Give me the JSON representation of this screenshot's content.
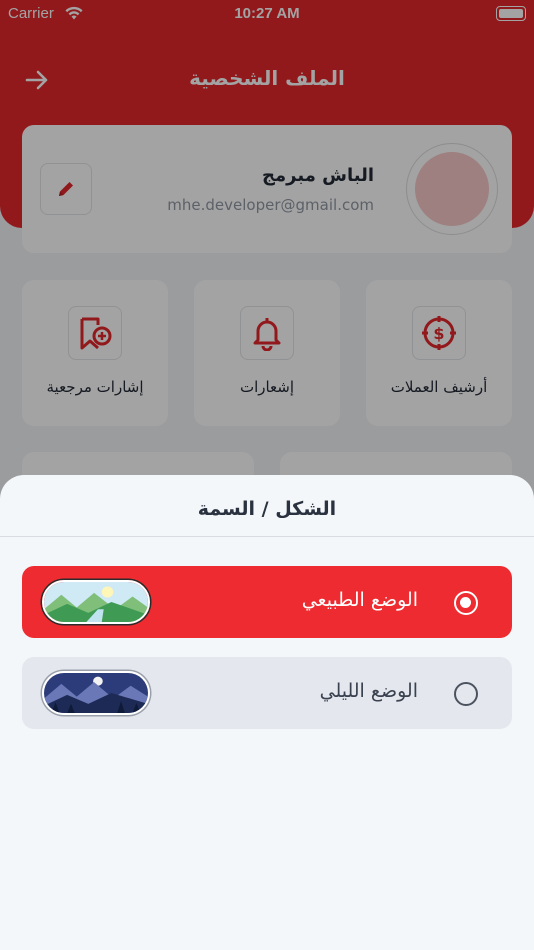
{
  "status_bar": {
    "carrier": "Carrier",
    "time": "10:27 AM"
  },
  "header": {
    "title": "الملف الشخصية"
  },
  "profile": {
    "name": "الباش مبرمج",
    "email": "mhe.developer@gmail.com"
  },
  "tiles": [
    {
      "label": "أرشيف العملات",
      "icon": "currency-archive-icon"
    },
    {
      "label": "إشعارات",
      "icon": "bell-icon"
    },
    {
      "label": "إشارات مرجعية",
      "icon": "bookmark-add-icon"
    }
  ],
  "sheet": {
    "title": "الشكل / السمة",
    "options": [
      {
        "label": "الوضع الطبيعي",
        "selected": true,
        "thumbnail": "day-landscape"
      },
      {
        "label": "الوضع الليلي",
        "selected": false,
        "thumbnail": "night-landscape"
      }
    ]
  },
  "colors": {
    "accent": "#ee2b30",
    "header_red": "#e3282c",
    "sheet_bg": "#f4f7fa"
  }
}
